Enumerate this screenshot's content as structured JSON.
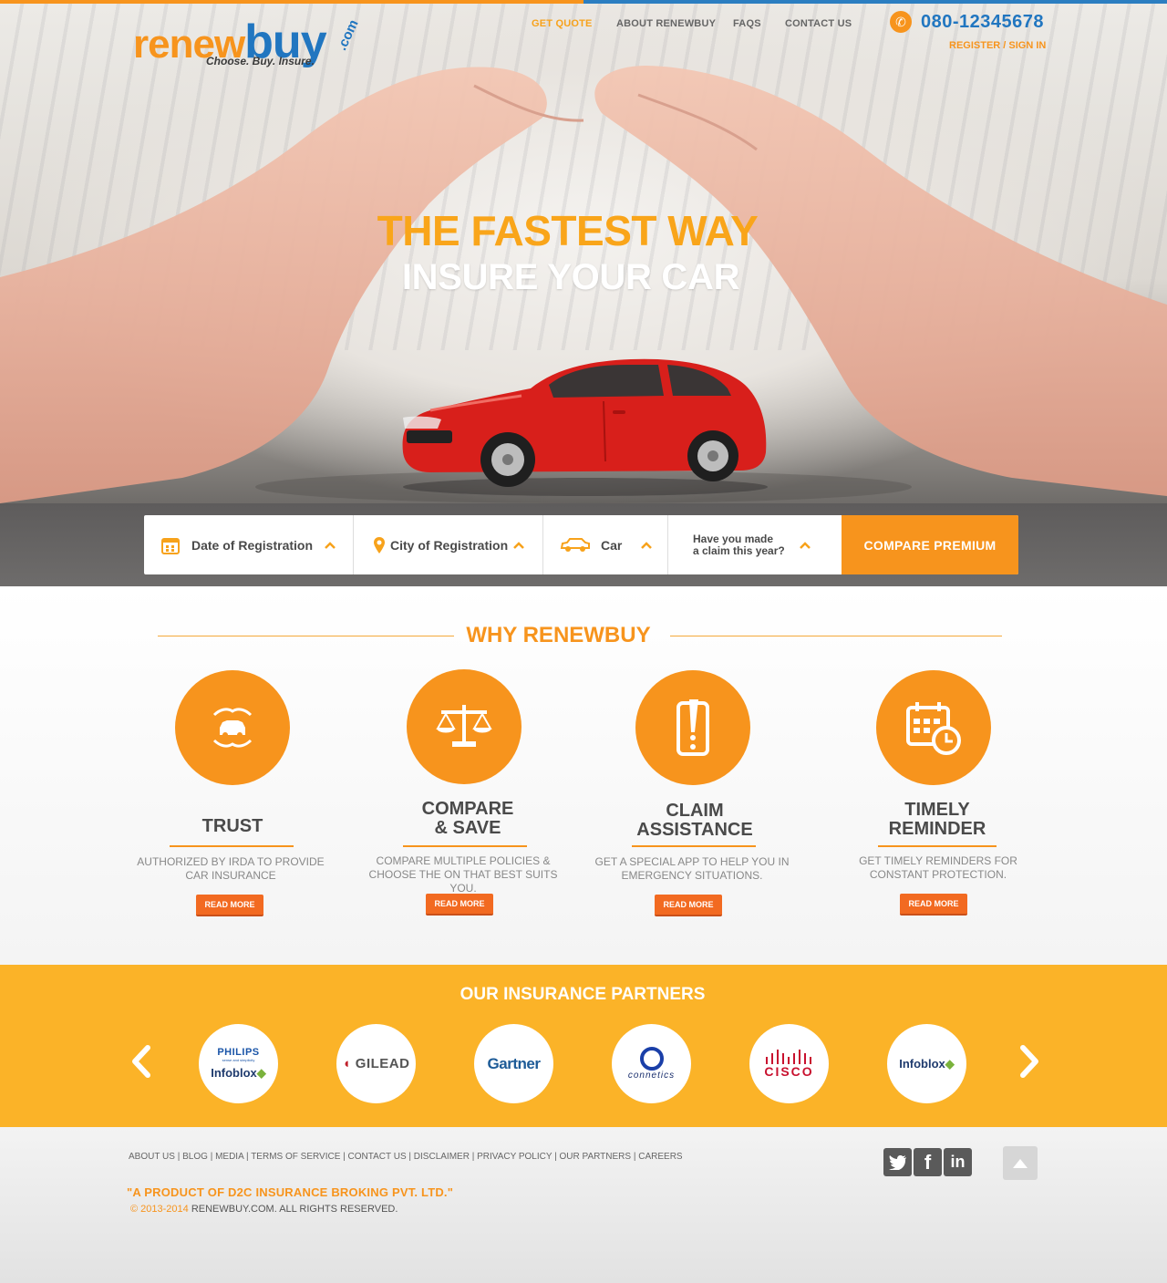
{
  "header": {
    "logo_main_1": "renew",
    "logo_main_2": "buy",
    "logo_com": ".com",
    "logo_tagline": "Choose. Buy. Insure.",
    "nav": [
      "GET QUOTE",
      "ABOUT RENEWBUY",
      "FAQS",
      "CONTACT US"
    ],
    "phone": "080-12345678",
    "register": "REGISTER / SIGN IN"
  },
  "hero": {
    "title": "THE FASTEST WAY",
    "subtitle": "INSURE YOUR CAR"
  },
  "form": {
    "date_label": "Date of Registration",
    "city_label": "City of Registration",
    "car_label": "Car",
    "claim_line1": "Have you made",
    "claim_line2": "a claim this year?",
    "compare_button": "COMPARE PREMIUM"
  },
  "why": {
    "title": "WHY RENEWBUY",
    "features": [
      {
        "title1": "TRUST",
        "title2": "",
        "desc1": "AUTHORIZED BY IRDA TO PROVIDE",
        "desc2": "CAR INSURANCE",
        "button": "READ MORE",
        "icon": "car-protection-icon"
      },
      {
        "title1": "COMPARE",
        "title2": "& SAVE",
        "desc1": "COMPARE MULTIPLE POLICIES &",
        "desc2": "CHOOSE THE ON THAT BEST SUITS YOU.",
        "button": "READ MORE",
        "icon": "scale-icon"
      },
      {
        "title1": "CLAIM",
        "title2": "ASSISTANCE",
        "desc1": "GET A SPECIAL APP TO HELP YOU IN",
        "desc2": "EMERGENCY SITUATIONS.",
        "button": "READ MORE",
        "icon": "phone-alert-icon"
      },
      {
        "title1": "TIMELY",
        "title2": "REMINDER",
        "desc1": "GET TIMELY REMINDERS FOR",
        "desc2": "CONSTANT PROTECTION.",
        "button": "READ MORE",
        "icon": "calendar-clock-icon"
      }
    ]
  },
  "partners": {
    "title": "OUR INSURANCE PARTNERS",
    "logos": [
      {
        "name": "PHILIPS",
        "sub": "sense and simplicity",
        "name2": "Infoblox"
      },
      {
        "name": "GILEAD"
      },
      {
        "name": "Gartner"
      },
      {
        "name": "connetics"
      },
      {
        "name": "CISCO"
      },
      {
        "name": "Infoblox"
      }
    ]
  },
  "footer": {
    "links": [
      "ABOUT US",
      "BLOG",
      "MEDIA",
      "TERMS OF SERVICE",
      "CONTACT US",
      "DISCLAIMER",
      "PRIVACY POLICY",
      "OUR PARTNERS",
      "CAREERS"
    ],
    "product": "\"A PRODUCT OF D2C INSURANCE BROKING PVT. LTD.\"",
    "copy_years": "© 2013-2014",
    "copy_text": "RENEWBUY.COM. ALL RIGHTS RESERVED.",
    "social": [
      "twitter-icon",
      "facebook-icon",
      "linkedin-icon"
    ]
  },
  "colors": {
    "accent": "#f7941d",
    "brand_blue": "#2176c0",
    "partners_bg": "#fbb328"
  }
}
